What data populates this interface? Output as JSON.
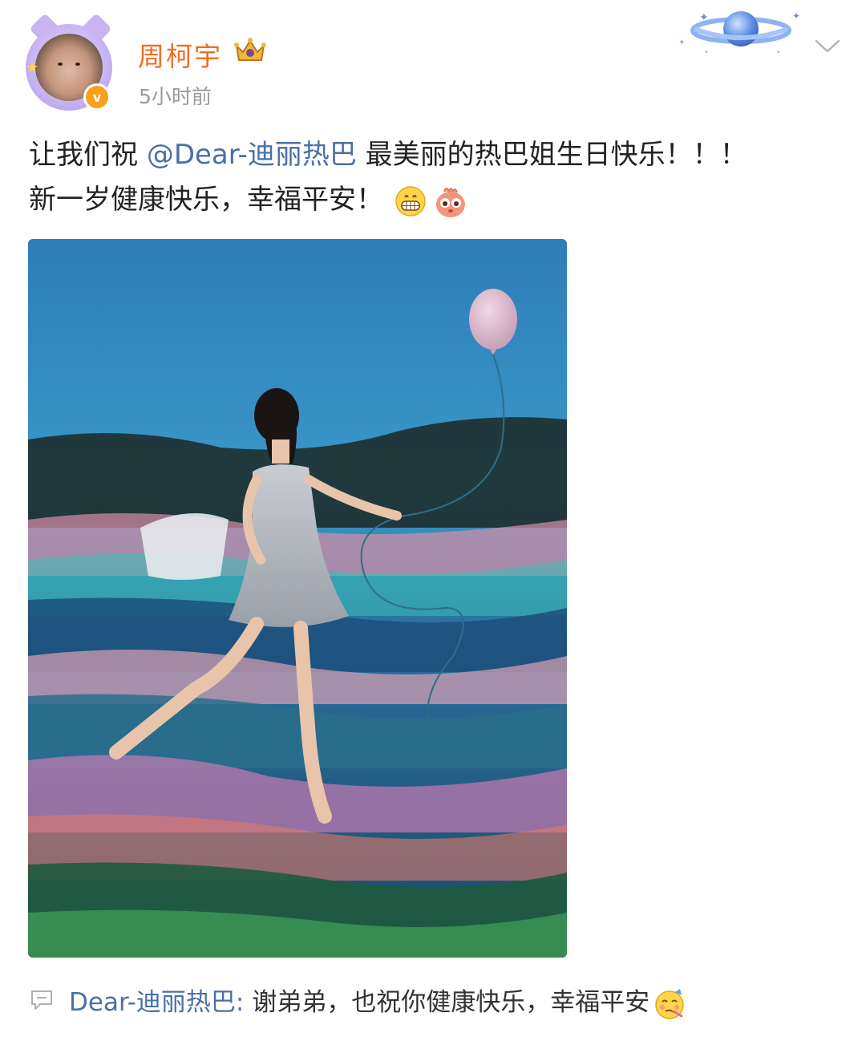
{
  "post": {
    "author": {
      "name": "周柯宇",
      "timestamp": "5小时前",
      "verified_badge_letter": "v",
      "avatar_icon": "avatar-photo",
      "badge_icon": "crown-icon"
    },
    "text_line1_prefix": "让我们祝 ",
    "mention": "@Dear-迪丽热巴",
    "text_line1_suffix": " 最美丽的热巴姐生日快乐！！！",
    "text_line2": "新一岁健康快乐，幸福平安！",
    "emojis": [
      "grin-emoji",
      "creature-emoji"
    ],
    "image": {
      "alt_icon": "photo-woman-balloon"
    },
    "decoration_icon": "planet-icon",
    "more_icon": "chevron-down-icon"
  },
  "comment": {
    "icon": "comment-icon",
    "author": "Dear-迪丽热巴",
    "separator": ": ",
    "text": "谢弟弟，也祝你健康快乐，幸福平安",
    "emoji": "woozy-face-emoji"
  },
  "colors": {
    "username": "#f26d1f",
    "mention": "#4a6fa8",
    "timestamp": "#9a9a9a",
    "verified": "#f7a21a"
  }
}
